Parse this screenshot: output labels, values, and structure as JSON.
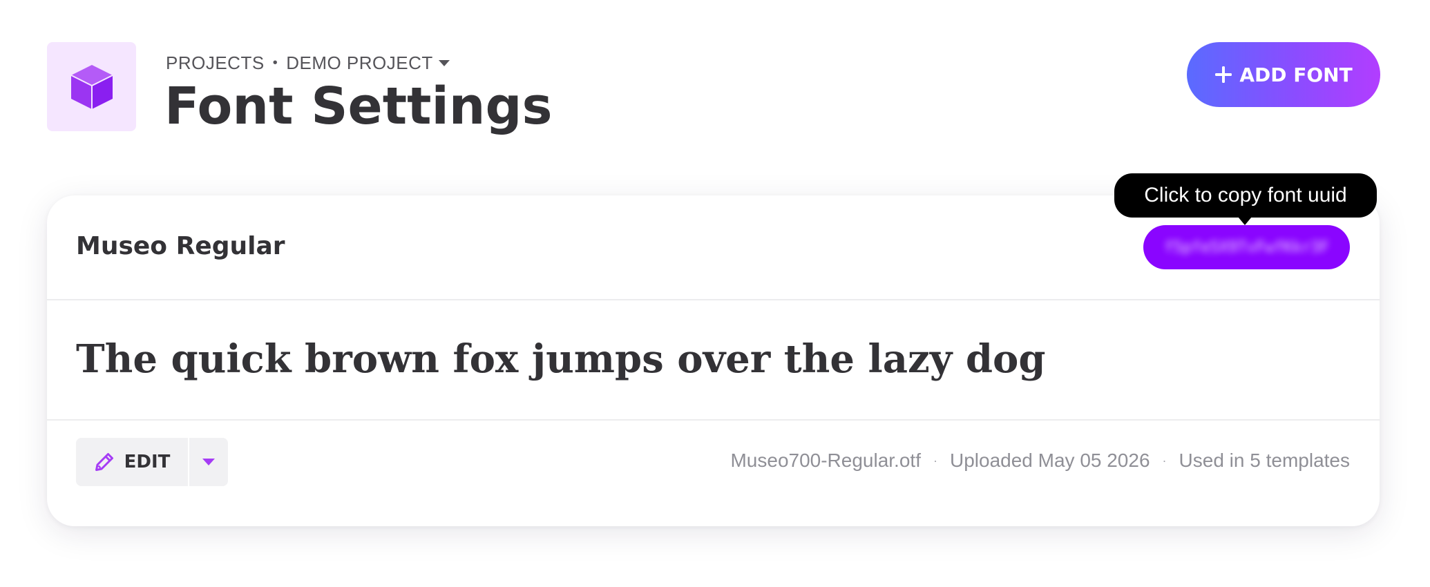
{
  "header": {
    "breadcrumb": {
      "root": "PROJECTS",
      "separator": "•",
      "current": "DEMO PROJECT"
    },
    "title": "Font Settings",
    "add_button": {
      "icon": "plus-icon",
      "label": "ADD FONT"
    },
    "project_icon": "cube-icon"
  },
  "font_card": {
    "name": "Museo Regular",
    "uuid": "f5pfe5X9TvFwfKkr3F",
    "preview_text": "The quick brown fox jumps over the lazy dog",
    "edit_button": {
      "icon": "pencil-icon",
      "label": "EDIT"
    },
    "meta": {
      "filename": "Museo700-Regular.otf",
      "uploaded": "Uploaded May 05 2026",
      "usage": "Used in 5 templates",
      "separator": "·"
    }
  },
  "tooltip": {
    "text": "Click to copy font uuid"
  },
  "colors": {
    "accent": "#8a05ff",
    "icon_purple": "#a53cf5",
    "icon_bg": "#f5e6ff",
    "gradient_start": "#5a6bff",
    "gradient_end": "#b23dff",
    "text_dark": "#333236",
    "text_muted": "#8f8f96"
  }
}
